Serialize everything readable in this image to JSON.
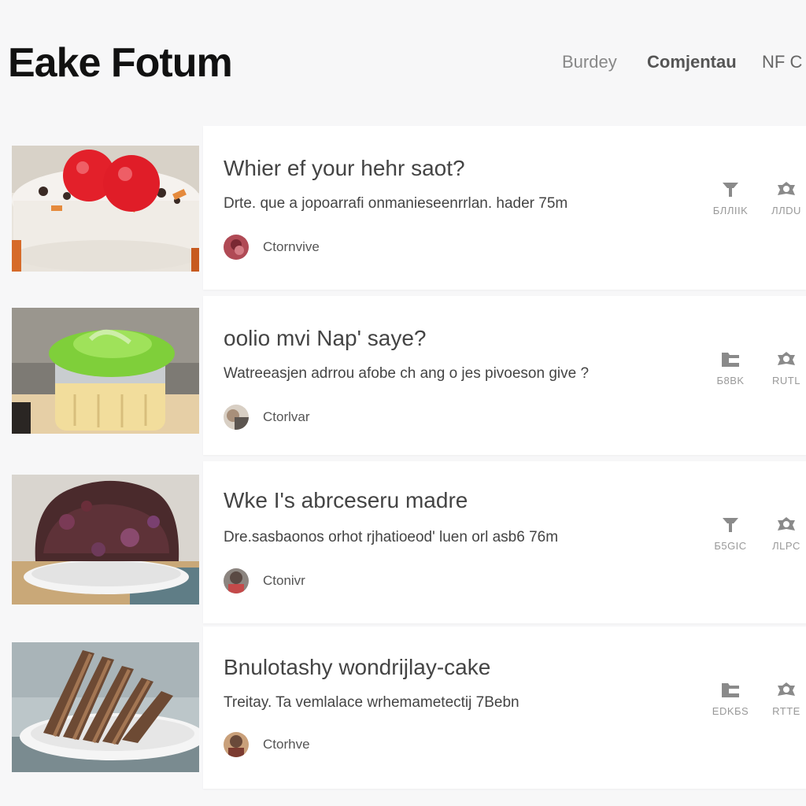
{
  "header": {
    "site_title": "Eake Fotum",
    "nav": [
      "Burdey",
      "Comjentau",
      "NF C"
    ]
  },
  "posts": [
    {
      "title": "Whier ef your hehr saot?",
      "excerpt": "Drte. que a jopoarrafi onmanieseenrrlan. hader 75m",
      "author": "Ctornvive",
      "stats": [
        {
          "icon": "pin-icon",
          "label": "БЛЛIIK"
        },
        {
          "icon": "badge-icon",
          "label": "ЛЛDU"
        }
      ],
      "image": "strawberry-cream-cake"
    },
    {
      "title": "oolio mvi Nap' saye?",
      "excerpt": "Watreeasjen adrrou afobe ch ang o jes pivoeson give ?",
      "author": "Ctorlvar",
      "stats": [
        {
          "icon": "folder-icon",
          "label": "Б8BK"
        },
        {
          "icon": "badge-icon",
          "label": "RUTL"
        }
      ],
      "image": "green-frosted-cupcake"
    },
    {
      "title": "Wke I's abrceseru madre",
      "excerpt": "Dre.sasbaonos orhot rjhatioeod' luen orl asb6 76m",
      "author": "Ctonivr",
      "stats": [
        {
          "icon": "pin-icon",
          "label": "Б5GIC"
        },
        {
          "icon": "badge-icon",
          "label": "ЛLPC"
        }
      ],
      "image": "chocolate-berry-cake"
    },
    {
      "title": "Bnulotashy wondrijlay-cake",
      "excerpt": "Treitay. Ta vemlalace wrhemametectij 7Bebn",
      "author": "Ctorhve",
      "stats": [
        {
          "icon": "folder-icon",
          "label": "ЕDKБS"
        },
        {
          "icon": "badge-icon",
          "label": "RTTE"
        }
      ],
      "image": "chocolate-wafer-cake"
    }
  ],
  "colors": {
    "page_bg": "#f7f7f8",
    "card_bg": "#ffffff",
    "title_text": "#111111",
    "icon_gray": "#8a8a8a"
  }
}
